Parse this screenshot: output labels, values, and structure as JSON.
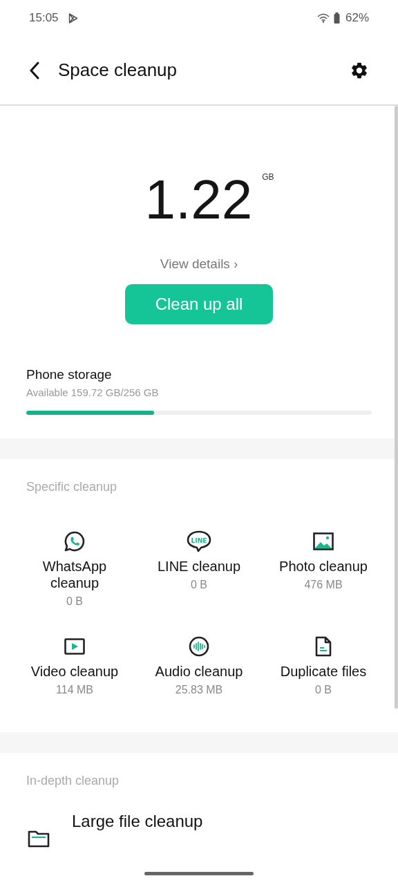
{
  "status_bar": {
    "time": "15:05",
    "battery": "62%"
  },
  "header": {
    "title": "Space cleanup"
  },
  "summary": {
    "amount": "1.22",
    "unit": "GB",
    "details_link": "View details",
    "details_chevron": "›",
    "button": "Clean up all"
  },
  "storage": {
    "label": "Phone storage",
    "available": "Available 159.72 GB/256 GB",
    "level": 0.37
  },
  "specific": {
    "heading": "Specific cleanup",
    "items": [
      {
        "kind": "whatsapp",
        "label": "WhatsApp cleanup",
        "size": "0 B"
      },
      {
        "kind": "line",
        "label": "LINE cleanup",
        "size": "0 B",
        "badge": "LINE"
      },
      {
        "kind": "photo",
        "label": "Photo cleanup",
        "size": "476 MB"
      },
      {
        "kind": "video",
        "label": "Video cleanup",
        "size": "114 MB"
      },
      {
        "kind": "audio",
        "label": "Audio cleanup",
        "size": "25.83 MB"
      },
      {
        "kind": "document",
        "label": "Duplicate files",
        "size": "0 B"
      }
    ]
  },
  "in_depth": {
    "heading": "In-depth cleanup",
    "items": [
      {
        "kind": "folder",
        "label": "Large file cleanup"
      }
    ]
  }
}
